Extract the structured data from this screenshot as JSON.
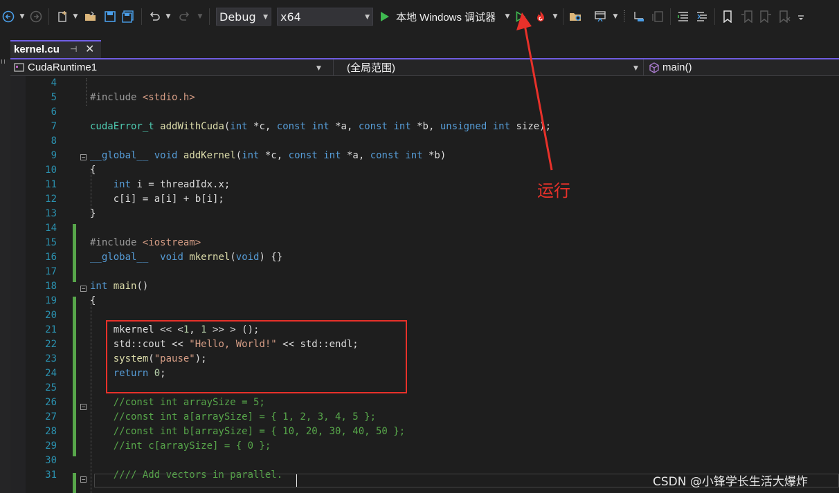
{
  "toolbar": {
    "config": "Debug",
    "platform": "x64",
    "debugger_label": "本地 Windows 调试器",
    "colors": {
      "play": "#3fb950",
      "hot_reload": "#e8312a"
    }
  },
  "tab": {
    "filename": "kernel.cu",
    "pin": "⊣",
    "close": "✕"
  },
  "nav": {
    "project": "CudaRuntime1",
    "scope": "(全局范围)",
    "member": "main()"
  },
  "editor": {
    "lines": [
      {
        "n": "4",
        "t": ""
      },
      {
        "n": "5",
        "t": "#include <stdio.h>"
      },
      {
        "n": "6",
        "t": ""
      },
      {
        "n": "7",
        "t": "cudaError_t addWithCuda(int *c, const int *a, const int *b, unsigned int size);"
      },
      {
        "n": "8",
        "t": ""
      },
      {
        "n": "9",
        "t": "__global__ void addKernel(int *c, const int *a, const int *b)"
      },
      {
        "n": "10",
        "t": "{"
      },
      {
        "n": "11",
        "t": "    int i = threadIdx.x;"
      },
      {
        "n": "12",
        "t": "    c[i] = a[i] + b[i];"
      },
      {
        "n": "13",
        "t": "}"
      },
      {
        "n": "14",
        "t": ""
      },
      {
        "n": "15",
        "t": "#include <iostream>"
      },
      {
        "n": "16",
        "t": "__global__  void mkernel(void) {}"
      },
      {
        "n": "17",
        "t": ""
      },
      {
        "n": "18",
        "t": "int main()"
      },
      {
        "n": "19",
        "t": "{"
      },
      {
        "n": "20",
        "t": ""
      },
      {
        "n": "21",
        "t": "    mkernel << <1, 1 >> > ();"
      },
      {
        "n": "22",
        "t": "    std::cout << \"Hello, World!\" << std::endl;"
      },
      {
        "n": "23",
        "t": "    system(\"pause\");"
      },
      {
        "n": "24",
        "t": "    return 0;"
      },
      {
        "n": "25",
        "t": ""
      },
      {
        "n": "26",
        "t": "    //const int arraySize = 5;"
      },
      {
        "n": "27",
        "t": "    //const int a[arraySize] = { 1, 2, 3, 4, 5 };"
      },
      {
        "n": "28",
        "t": "    //const int b[arraySize] = { 10, 20, 30, 40, 50 };"
      },
      {
        "n": "29",
        "t": "    //int c[arraySize] = { 0 };"
      },
      {
        "n": "30",
        "t": ""
      },
      {
        "n": "31",
        "t": "    //// Add vectors in parallel."
      }
    ]
  },
  "annotation": {
    "text": "运行",
    "color": "#e8312a"
  },
  "watermark": "CSDN @小锋学长生活大爆炸"
}
